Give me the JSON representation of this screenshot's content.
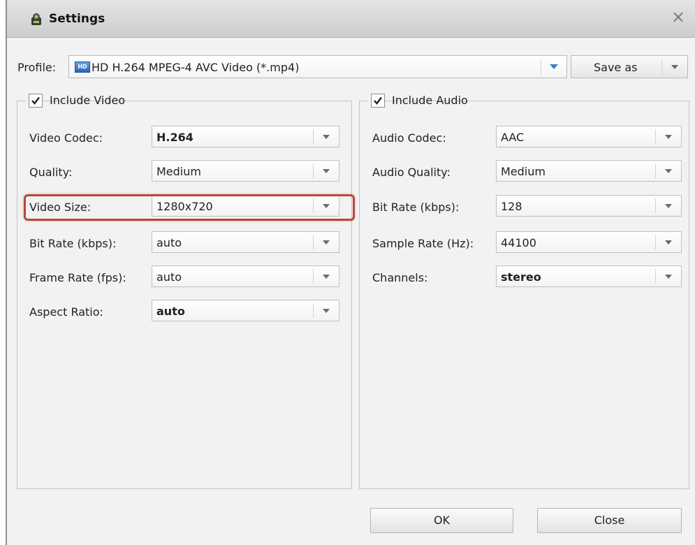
{
  "window": {
    "title": "Settings",
    "close_glyph": "×"
  },
  "profile": {
    "label": "Profile:",
    "badge": "HD",
    "value": "HD H.264 MPEG-4 AVC Video (*.mp4)",
    "save_as_label": "Save as"
  },
  "video": {
    "include_label": "Include Video",
    "checked": true,
    "fields": [
      {
        "label": "Video Codec:",
        "value": "H.264"
      },
      {
        "label": "Quality:",
        "value": "Medium"
      },
      {
        "label": "Video Size:",
        "value": "1280x720"
      },
      {
        "label": "Bit Rate (kbps):",
        "value": "auto"
      },
      {
        "label": "Frame Rate (fps):",
        "value": "auto"
      },
      {
        "label": "Aspect Ratio:",
        "value": "auto"
      }
    ]
  },
  "audio": {
    "include_label": "Include Audio",
    "checked": true,
    "fields": [
      {
        "label": "Audio Codec:",
        "value": "AAC"
      },
      {
        "label": "Audio Quality:",
        "value": "Medium"
      },
      {
        "label": "Bit Rate (kbps):",
        "value": "128"
      },
      {
        "label": "Sample Rate (Hz):",
        "value": "44100"
      },
      {
        "label": "Channels:",
        "value": "stereo"
      }
    ]
  },
  "buttons": {
    "ok": "OK",
    "close": "Close"
  },
  "colors": {
    "highlight": "#b9473a",
    "dropdown_arrow_blue": "#3d7dc9"
  }
}
